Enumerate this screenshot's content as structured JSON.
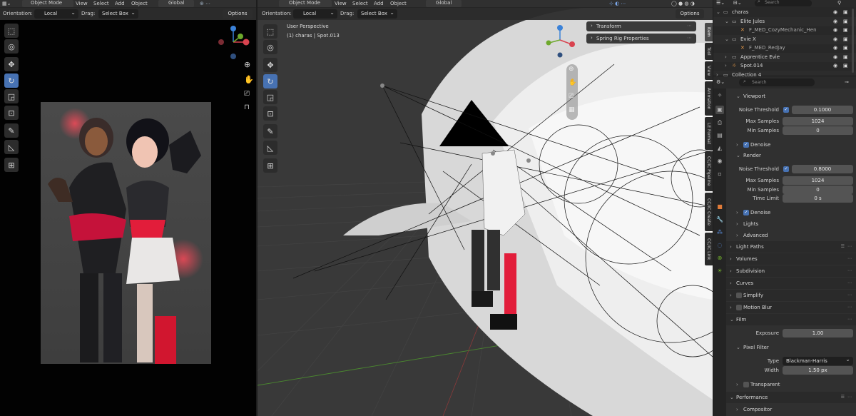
{
  "left_header": {
    "menus": [
      "View",
      "Select",
      "Add",
      "Object"
    ],
    "mode": "Object Mode",
    "transform_space": "Global",
    "orientation_label": "Orientation:",
    "orientation_value": "Local",
    "drag_label": "Drag:",
    "drag_value": "Select Box",
    "options_label": "Options"
  },
  "viewport_header": {
    "mode": "Object Mode",
    "menus": [
      "View",
      "Select",
      "Add",
      "Object"
    ],
    "transform_space": "Global",
    "orientation_label": "Orientation:",
    "orientation_value": "Local",
    "drag_label": "Drag:",
    "drag_value": "Select Box",
    "options_label": "Options"
  },
  "viewport": {
    "view_name": "User Perspective",
    "collection_info": "(1) charas | Spot.013",
    "sidebar_panels": [
      "Transform",
      "Spring Rig Properties"
    ],
    "sidebar_tabs": [
      "Item",
      "Tool",
      "View",
      "Animation",
      "LE Format",
      "CC/iC Pipeline",
      "CC/iC Create",
      "CC/iC Link"
    ]
  },
  "gizmo_axes": {
    "x": "X",
    "y": "Y",
    "z": "Z"
  },
  "outliner": {
    "search_placeholder": "Search",
    "rows": [
      {
        "name": "charas",
        "indent": 0
      },
      {
        "name": "Elite Jules",
        "indent": 1
      },
      {
        "name": "F_MED_CozyMechanic_Hen",
        "indent": 2
      },
      {
        "name": "Evie X",
        "indent": 1
      },
      {
        "name": "F_MED_RedJay",
        "indent": 2
      },
      {
        "name": "Apprentice Evie",
        "indent": 1
      },
      {
        "name": "Spot.014",
        "indent": 1
      },
      {
        "name": "Collection 4",
        "indent": 0
      }
    ]
  },
  "properties": {
    "search_placeholder": "Search",
    "viewport_section": {
      "title": "Viewport",
      "noise_threshold_label": "Noise Threshold",
      "noise_threshold": "0.1000",
      "max_samples_label": "Max Samples",
      "max_samples": "1024",
      "min_samples_label": "Min Samples",
      "min_samples": "0",
      "denoise_label": "Denoise"
    },
    "render_section": {
      "title": "Render",
      "noise_threshold_label": "Noise Threshold",
      "noise_threshold": "0.8000",
      "max_samples_label": "Max Samples",
      "max_samples": "1024",
      "min_samples_label": "Min Samples",
      "min_samples": "0",
      "time_limit_label": "Time Limit",
      "time_limit": "0 s",
      "denoise_label": "Denoise"
    },
    "lights_label": "Lights",
    "advanced_label": "Advanced",
    "panels": [
      "Light Paths",
      "Volumes",
      "Subdivision",
      "Curves",
      "Simplify",
      "Motion Blur"
    ],
    "film": {
      "title": "Film",
      "exposure_label": "Exposure",
      "exposure": "1.00",
      "pixel_filter_label": "Pixel Filter",
      "type_label": "Type",
      "type_value": "Blackman-Harris",
      "width_label": "Width",
      "width_value": "1.50 px",
      "transparent_label": "Transparent"
    },
    "performance_label": "Performance",
    "compositor_label": "Compositor"
  },
  "colors": {
    "accent": "#4772b3",
    "axis_x": "#d9434f",
    "axis_y": "#6ea92c",
    "axis_z": "#3b82d8"
  }
}
